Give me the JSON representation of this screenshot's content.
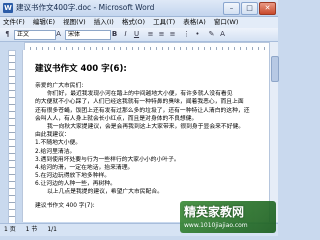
{
  "window": {
    "title": "建议书作文400字.doc - Microsoft Word"
  },
  "menubar": {
    "items": [
      "文件(F)",
      "编辑(E)",
      "视图(V)",
      "插入(I)",
      "格式(O)",
      "工具(T)",
      "表格(A)",
      "窗口(W)"
    ]
  },
  "toolbar": {
    "style": "正文",
    "font": "宋体"
  },
  "document": {
    "title": "建议书作文 400 字(6):",
    "salutation": "亲爱的广大市民们:",
    "lines": [
      "你们好，最近我发现小河在踏上的中间越地大小便，有许多就人没有看见",
      "的大便就不小心踩了，人们已经这我就有一种特鼻的臭味，闻着我恶心，而且上面",
      "还有很多苍蝇，饭团上还有发有过那么多的垃圾了，还有一种特让人清白的这种，还",
      "会叫人人，有人身上就会长小红点，而且是对身体的不良想健。",
      "我一向秋大家提建议，会是会再我到这上大家带来，很到身于显会来不好健。",
      "由此我建议：",
      "1.不随地大小便。",
      "2.给河里清洁。",
      "3.遇到使用坏处要与行为一些样行的大家小小的小叶子。",
      "4.给河的滑，一定在地话，抬来清理。",
      "5.在河边玩得放下地多种样。",
      "6.让河边的人种一些，再树种。",
      "以上几点是我提的建议，希望广大市民配合。"
    ],
    "footer": "建议书作文 400 字(7):"
  },
  "statusbar": {
    "page": "1 页",
    "section": "1 节",
    "pos": "1/1"
  },
  "watermark": {
    "main": "精英家教网",
    "sub": "www.1010jiajiao.com"
  }
}
